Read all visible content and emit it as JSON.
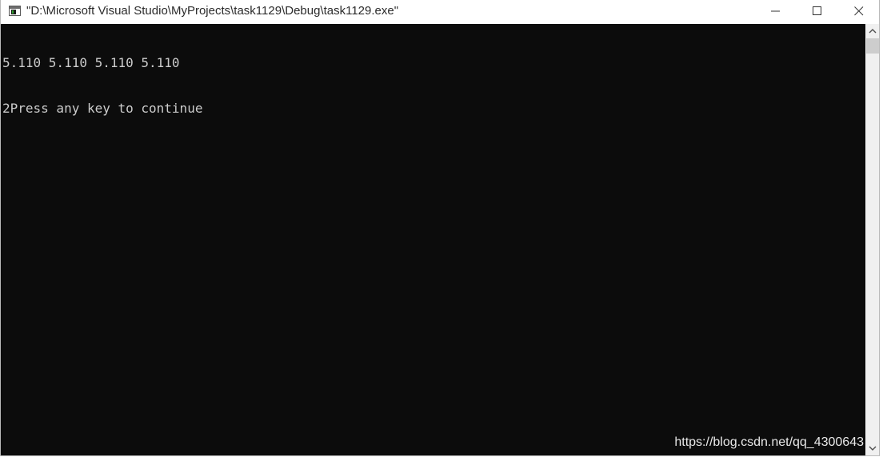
{
  "window": {
    "title": "\"D:\\Microsoft Visual Studio\\MyProjects\\task1129\\Debug\\task1129.exe\"",
    "icon": "console-app-icon"
  },
  "caption_buttons": {
    "minimize_icon": "minimize-icon",
    "maximize_icon": "maximize-icon",
    "close_icon": "close-icon"
  },
  "console": {
    "lines": [
      "5.110 5.110 5.110 5.110",
      "2Press any key to continue"
    ],
    "background": "#0c0c0c",
    "foreground": "#cccccc"
  },
  "watermark": {
    "text": "https://blog.csdn.net/qq_4300643"
  },
  "scrollbar": {
    "up_icon": "chevron-up-icon",
    "down_icon": "chevron-down-icon"
  }
}
